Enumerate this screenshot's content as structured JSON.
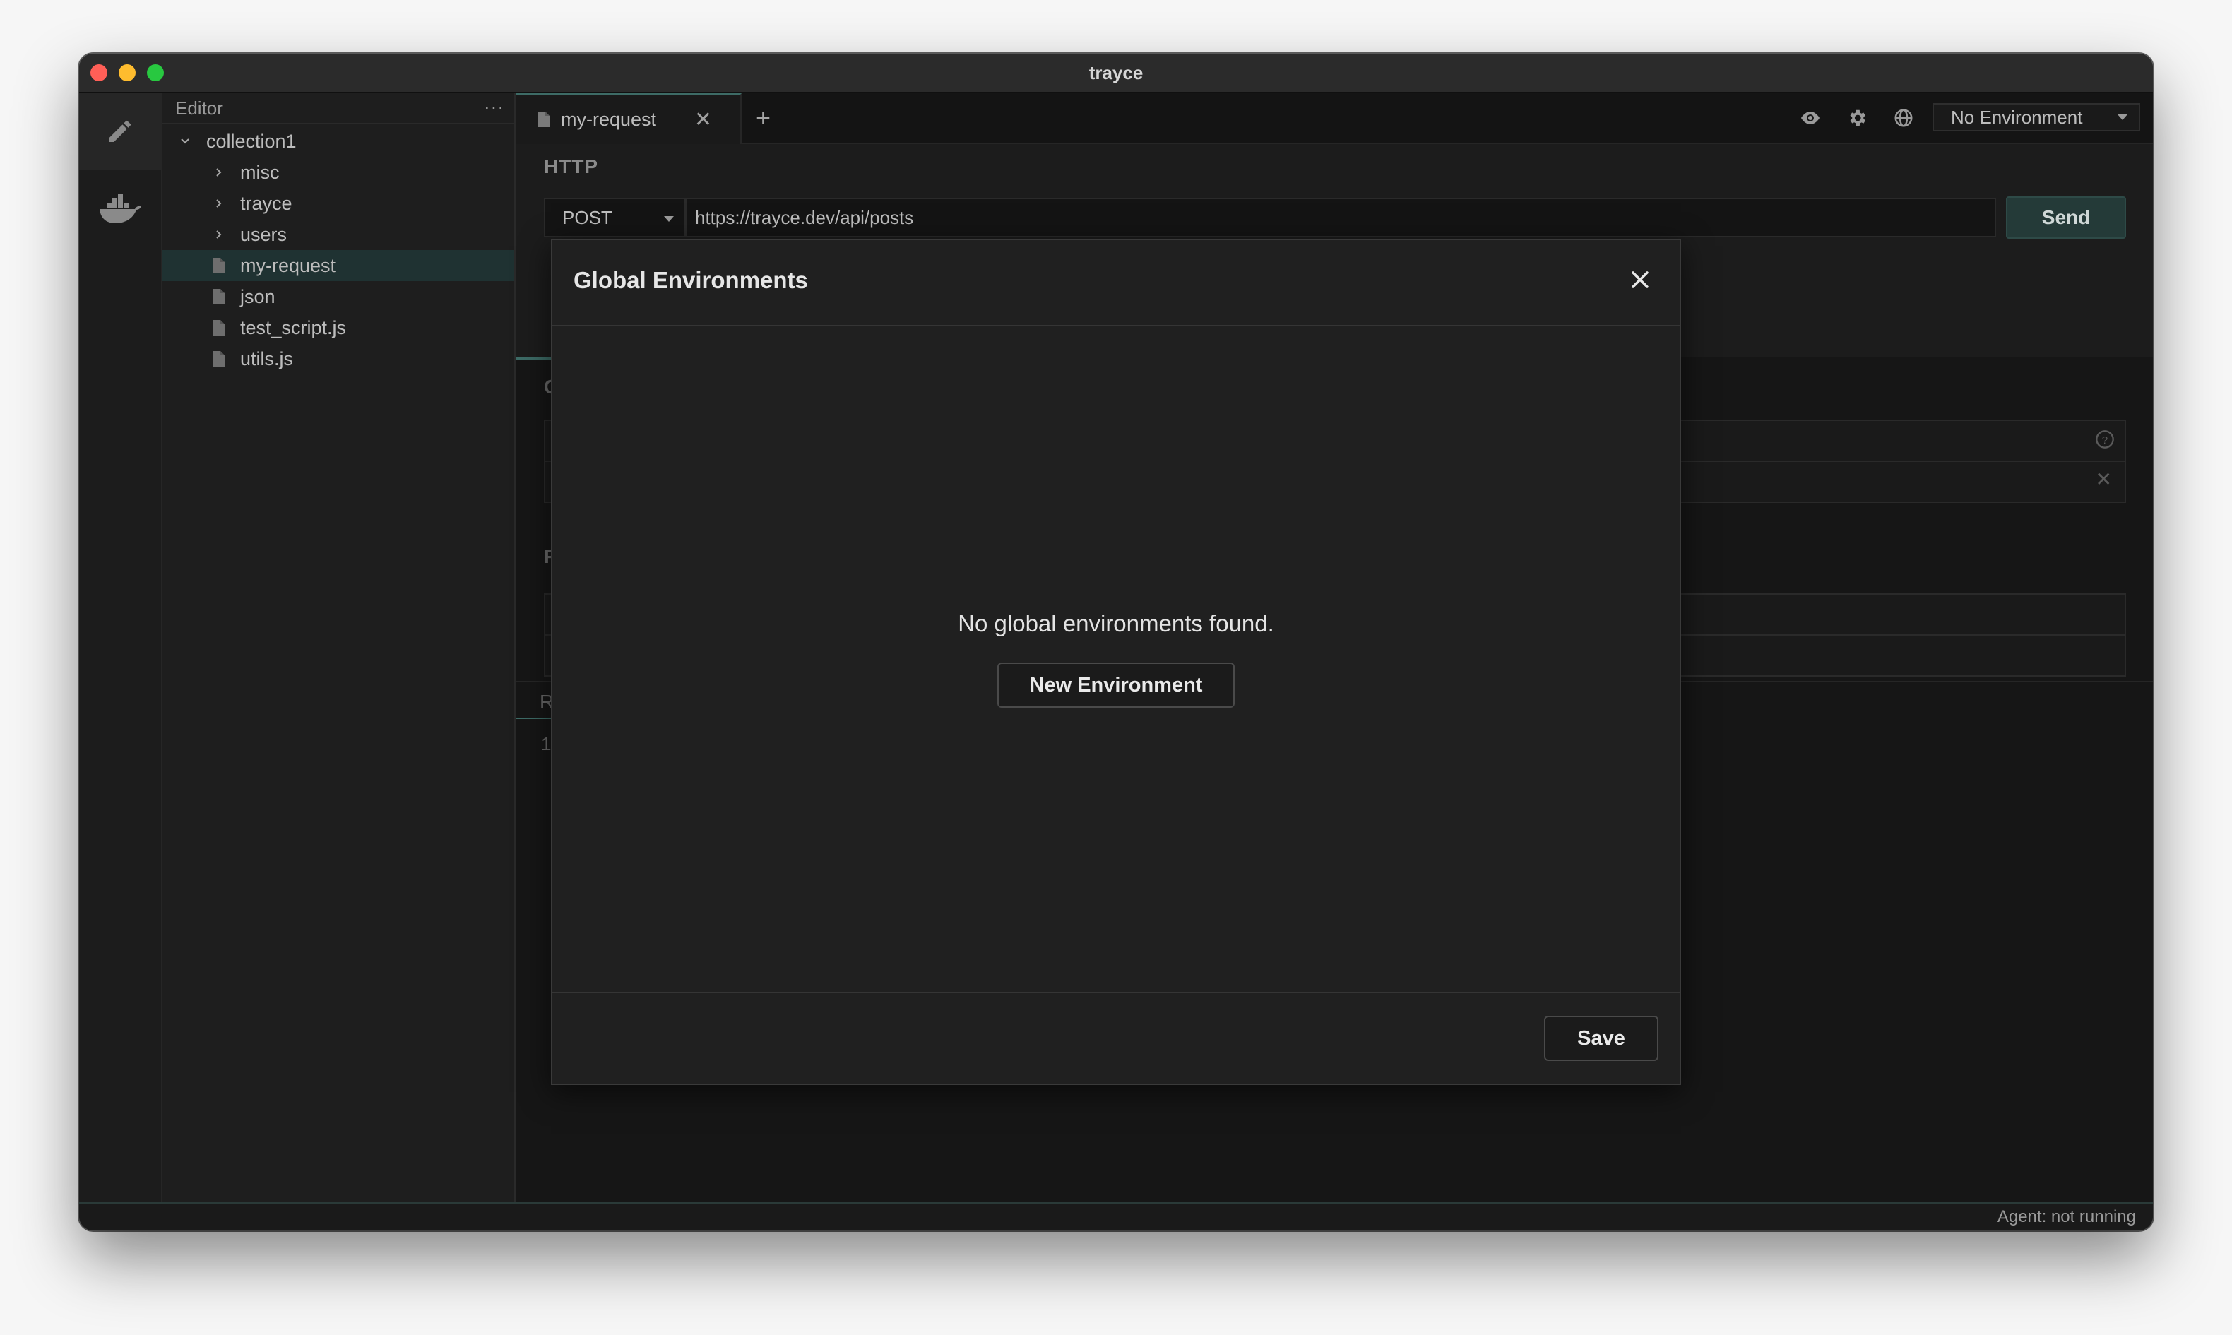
{
  "window": {
    "title": "trayce"
  },
  "activity_bar": {
    "items": [
      {
        "icon": "pencil-icon",
        "active": true
      },
      {
        "icon": "docker-whale-icon",
        "active": false
      }
    ]
  },
  "sidebar": {
    "header": "Editor",
    "more_label": "···",
    "tree": [
      {
        "label": "collection1",
        "type": "folder",
        "expanded": true,
        "depth": 0
      },
      {
        "label": "misc",
        "type": "folder",
        "expanded": false,
        "depth": 1
      },
      {
        "label": "trayce",
        "type": "folder",
        "expanded": false,
        "depth": 1
      },
      {
        "label": "users",
        "type": "folder",
        "expanded": false,
        "depth": 1
      },
      {
        "label": "my-request",
        "type": "file",
        "selected": true,
        "depth": 1
      },
      {
        "label": "json",
        "type": "file",
        "depth": 1
      },
      {
        "label": "test_script.js",
        "type": "file",
        "depth": 1
      },
      {
        "label": "utils.js",
        "type": "file",
        "depth": 1
      }
    ]
  },
  "tabs": [
    {
      "label": "my-request",
      "active": true
    }
  ],
  "toolbar": {
    "environment_select": "No Environment"
  },
  "request": {
    "section_label": "HTTP",
    "method": "POST",
    "url": "https://trayce.dev/api/posts",
    "send_label": "Send"
  },
  "background_hints": {
    "letter_c": "C",
    "letter_p": "P",
    "letter_r": "R",
    "line_1": "1"
  },
  "modal": {
    "title": "Global Environments",
    "empty_message": "No global environments found.",
    "new_env_label": "New Environment",
    "save_label": "Save"
  },
  "status_bar": {
    "agent_status": "Agent: not running"
  },
  "colors": {
    "accent": "#3d6b66",
    "send_bg": "#243a38",
    "selected_row": "#1f3232"
  }
}
